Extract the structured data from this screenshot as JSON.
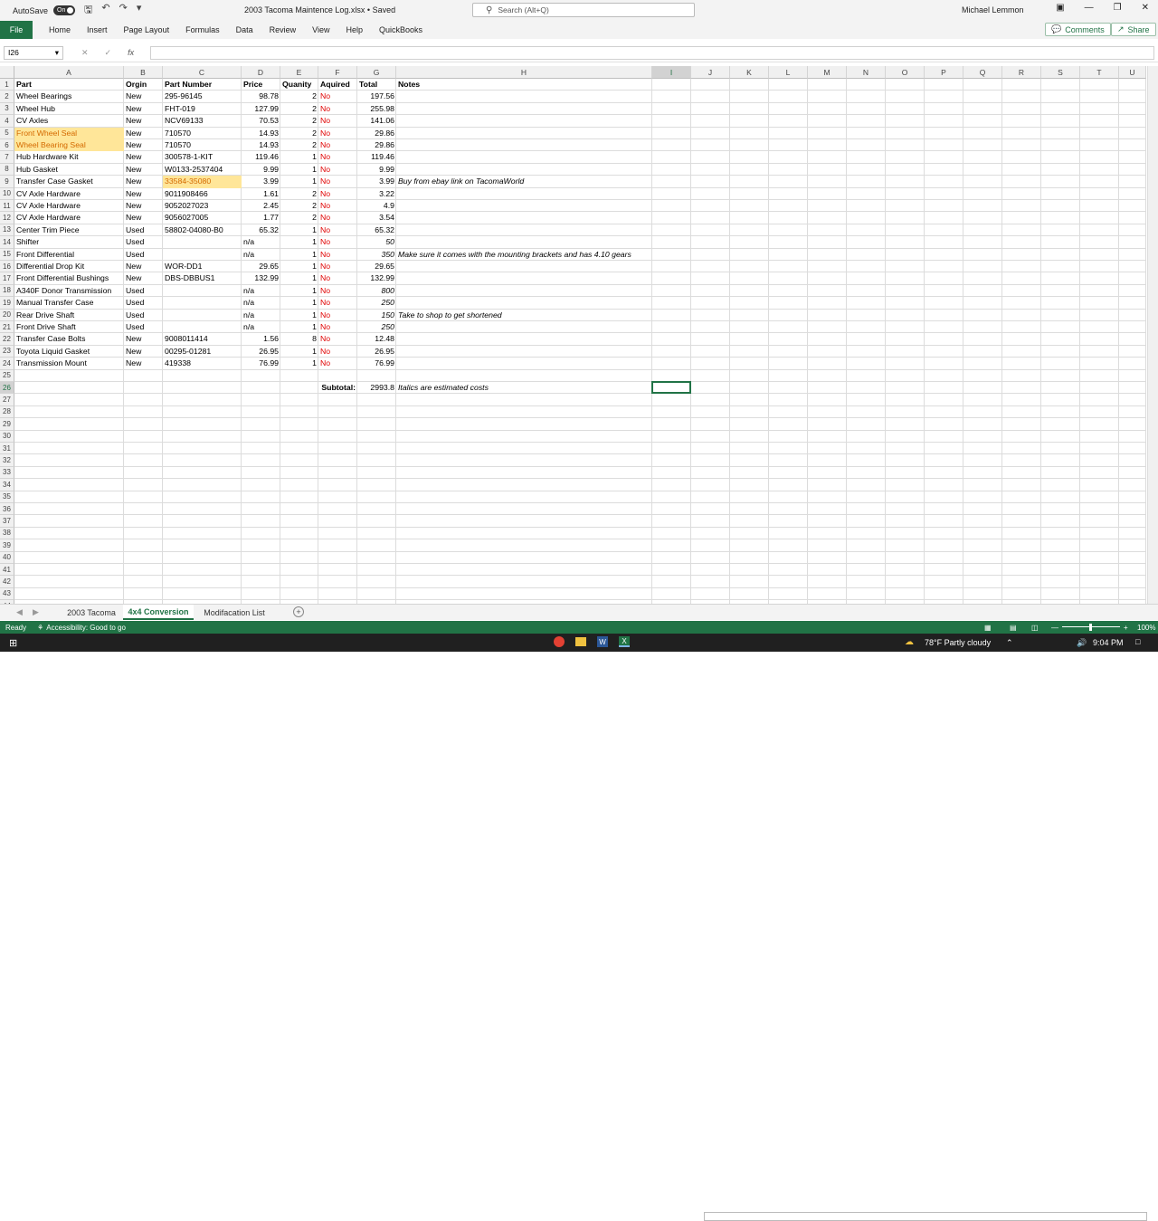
{
  "titlebar": {
    "autosave_label": "AutoSave",
    "autosave_state": "On",
    "doc_title": "2003 Tacoma Maintence Log.xlsx • Saved",
    "search_placeholder": "Search (Alt+Q)",
    "user_name": "Michael Lemmon"
  },
  "ribbon": {
    "file": "File",
    "tabs": [
      "Home",
      "Insert",
      "Page Layout",
      "Formulas",
      "Data",
      "Review",
      "View",
      "Help",
      "QuickBooks"
    ],
    "comments": "Comments",
    "share": "Share"
  },
  "formula_bar": {
    "name_box": "I26",
    "fx": "fx",
    "value": ""
  },
  "columns": [
    "A",
    "B",
    "C",
    "D",
    "E",
    "F",
    "G",
    "H",
    "I",
    "J",
    "K",
    "L",
    "M",
    "N",
    "O",
    "P",
    "Q",
    "R",
    "S",
    "T",
    "U"
  ],
  "selected_cell": {
    "col": "I",
    "row": 26
  },
  "rows": [
    {
      "n": 1,
      "part": "Part",
      "orgin": "Orgin",
      "part_number": "Part Number",
      "price": "Price",
      "quantity": "Quanity",
      "acquired": "Aquired",
      "total": "Total",
      "notes": "Notes",
      "header": true
    },
    {
      "n": 2,
      "part": "Wheel Bearings",
      "orgin": "New",
      "part_number": "295-96145",
      "price": "98.78",
      "quantity": "2",
      "acquired": "No",
      "total": "197.56",
      "notes": ""
    },
    {
      "n": 3,
      "part": "Wheel Hub",
      "orgin": "New",
      "part_number": "FHT-019",
      "price": "127.99",
      "quantity": "2",
      "acquired": "No",
      "total": "255.98",
      "notes": ""
    },
    {
      "n": 4,
      "part": "CV Axles",
      "orgin": "New",
      "part_number": "NCV69133",
      "price": "70.53",
      "quantity": "2",
      "acquired": "No",
      "total": "141.06",
      "notes": ""
    },
    {
      "n": 5,
      "part": "Front Wheel Seal",
      "orgin": "New",
      "part_number": "710570",
      "price": "14.93",
      "quantity": "2",
      "acquired": "No",
      "total": "29.86",
      "notes": "",
      "hl_part": true
    },
    {
      "n": 6,
      "part": "Wheel Bearing Seal",
      "orgin": "New",
      "part_number": "710570",
      "price": "14.93",
      "quantity": "2",
      "acquired": "No",
      "total": "29.86",
      "notes": "",
      "hl_part": true
    },
    {
      "n": 7,
      "part": "Hub Hardware Kit",
      "orgin": "New",
      "part_number": "300578-1-KIT",
      "price": "119.46",
      "quantity": "1",
      "acquired": "No",
      "total": "119.46",
      "notes": ""
    },
    {
      "n": 8,
      "part": "Hub Gasket",
      "orgin": "New",
      "part_number": "W0133-2537404",
      "price": "9.99",
      "quantity": "1",
      "acquired": "No",
      "total": "9.99",
      "notes": ""
    },
    {
      "n": 9,
      "part": "Transfer Case Gasket",
      "orgin": "New",
      "part_number": "33584-35080",
      "price": "3.99",
      "quantity": "1",
      "acquired": "No",
      "total": "3.99",
      "notes": "Buy from ebay link on TacomaWorld",
      "hl_pn": true
    },
    {
      "n": 10,
      "part": "CV Axle Hardware",
      "orgin": "New",
      "part_number": "9011908466",
      "price": "1.61",
      "quantity": "2",
      "acquired": "No",
      "total": "3.22",
      "notes": ""
    },
    {
      "n": 11,
      "part": "CV Axle Hardware",
      "orgin": "New",
      "part_number": "9052027023",
      "price": "2.45",
      "quantity": "2",
      "acquired": "No",
      "total": "4.9",
      "notes": ""
    },
    {
      "n": 12,
      "part": "CV Axle Hardware",
      "orgin": "New",
      "part_number": "9056027005",
      "price": "1.77",
      "quantity": "2",
      "acquired": "No",
      "total": "3.54",
      "notes": ""
    },
    {
      "n": 13,
      "part": "Center Trim Piece",
      "orgin": "Used",
      "part_number": "58802-04080-B0",
      "price": "65.32",
      "quantity": "1",
      "acquired": "No",
      "total": "65.32",
      "notes": ""
    },
    {
      "n": 14,
      "part": "Shifter",
      "orgin": "Used",
      "part_number": "",
      "price": "n/a",
      "quantity": "1",
      "acquired": "No",
      "total": "50",
      "notes": "",
      "est": true
    },
    {
      "n": 15,
      "part": "Front Differential",
      "orgin": "Used",
      "part_number": "",
      "price": "n/a",
      "quantity": "1",
      "acquired": "No",
      "total": "350",
      "notes": "Make sure it comes with the mounting brackets and has 4.10 gears",
      "est": true
    },
    {
      "n": 16,
      "part": "Differential Drop Kit",
      "orgin": "New",
      "part_number": "WOR-DD1",
      "price": "29.65",
      "quantity": "1",
      "acquired": "No",
      "total": "29.65",
      "notes": ""
    },
    {
      "n": 17,
      "part": "Front Differential Bushings",
      "orgin": "New",
      "part_number": "DBS-DBBUS1",
      "price": "132.99",
      "quantity": "1",
      "acquired": "No",
      "total": "132.99",
      "notes": ""
    },
    {
      "n": 18,
      "part": "A340F Donor Transmission",
      "orgin": "Used",
      "part_number": "",
      "price": "n/a",
      "quantity": "1",
      "acquired": "No",
      "total": "800",
      "notes": "",
      "est": true
    },
    {
      "n": 19,
      "part": "Manual Transfer Case",
      "orgin": "Used",
      "part_number": "",
      "price": "n/a",
      "quantity": "1",
      "acquired": "No",
      "total": "250",
      "notes": "",
      "est": true
    },
    {
      "n": 20,
      "part": "Rear Drive Shaft",
      "orgin": "Used",
      "part_number": "",
      "price": "n/a",
      "quantity": "1",
      "acquired": "No",
      "total": "150",
      "notes": "Take to shop to get shortened",
      "est": true
    },
    {
      "n": 21,
      "part": "Front Drive Shaft",
      "orgin": "Used",
      "part_number": "",
      "price": "n/a",
      "quantity": "1",
      "acquired": "No",
      "total": "250",
      "notes": "",
      "est": true
    },
    {
      "n": 22,
      "part": "Transfer Case Bolts",
      "orgin": "New",
      "part_number": "9008011414",
      "price": "1.56",
      "quantity": "8",
      "acquired": "No",
      "total": "12.48",
      "notes": ""
    },
    {
      "n": 23,
      "part": "Toyota Liquid Gasket",
      "orgin": "New",
      "part_number": "00295-01281",
      "price": "26.95",
      "quantity": "1",
      "acquired": "No",
      "total": "26.95",
      "notes": ""
    },
    {
      "n": 24,
      "part": "Transmission Mount",
      "orgin": "New",
      "part_number": "419338",
      "price": "76.99",
      "quantity": "1",
      "acquired": "No",
      "total": "76.99",
      "notes": ""
    }
  ],
  "subtotal": {
    "label": "Subtotal:",
    "value": "2993.8",
    "note": "Italics are estimated costs"
  },
  "row_count": 44,
  "sheet_tabs": [
    {
      "label": "2003 Tacoma",
      "active": false
    },
    {
      "label": "4x4 Conversion",
      "active": true
    },
    {
      "label": "Modifacation List",
      "active": false
    }
  ],
  "status": {
    "ready": "Ready",
    "accessibility": "Accessibility: Good to go",
    "zoom": "100%"
  },
  "taskbar": {
    "weather": "78°F  Partly cloudy",
    "time": "9:04 PM"
  },
  "colors": {
    "excel_green": "#217346",
    "highlight_fill": "#ffe699",
    "highlight_text": "#d46a00",
    "no_red": "#e00000"
  }
}
